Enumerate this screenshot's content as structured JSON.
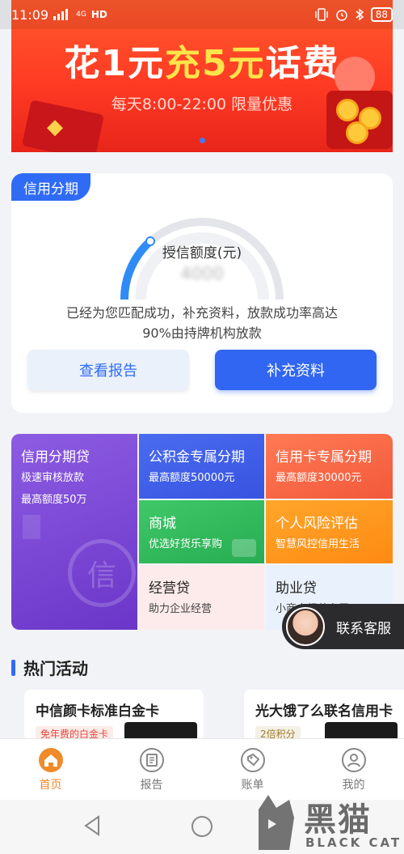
{
  "status_bar": {
    "time": "11:09",
    "network": "4G",
    "hd": "HD",
    "battery": "88"
  },
  "banner": {
    "title_part1": "花1元",
    "title_part2": "充5元",
    "title_part3": "话费",
    "subtitle": "每天8:00-22:00 限量优惠"
  },
  "credit": {
    "tag": "信用分期",
    "gauge_label": "授信额度(元)",
    "gauge_value": "4000",
    "desc_line1": "已经为您匹配成功，补充资料，放款成功率高达",
    "desc_line2": "90%由持牌机构放款",
    "btn_report": "查看报告",
    "btn_supplement": "补充资料"
  },
  "products": {
    "big": {
      "title": "信用分期贷",
      "sub1": "极速审核放款",
      "sub2": "最高额度50万",
      "seal": "信"
    },
    "a": {
      "title": "公积金专属分期",
      "sub": "最高额度50000元"
    },
    "b": {
      "title": "信用卡专属分期",
      "sub": "最高额度30000元"
    },
    "c": {
      "title": "商城",
      "sub": "优选好货乐享购"
    },
    "d": {
      "title": "个人风险评估",
      "sub": "智慧风控信用生活"
    },
    "e": {
      "title": "经营贷",
      "sub": "助力企业经营"
    },
    "f": {
      "title": "助业贷",
      "sub": "小商户经营专属"
    }
  },
  "contact": {
    "label": "联系客服"
  },
  "hot": {
    "title": "热门活动",
    "cards": [
      {
        "title": "中信颜卡标准白金卡",
        "badge": "免年费的白金卡"
      },
      {
        "title": "光大饿了么联名信用卡",
        "badge": "2倍积分"
      }
    ]
  },
  "nav": {
    "items": [
      {
        "label": "首页"
      },
      {
        "label": "报告"
      },
      {
        "label": "账单"
      },
      {
        "label": "我的"
      }
    ]
  },
  "watermark": {
    "cn": "黑猫",
    "en": "BLACK CAT"
  },
  "colors": {
    "accent": "#2f6bf5",
    "nav_active": "#f08a2a",
    "banner_red": "#ff3b24"
  },
  "icons": [
    "signal-icon",
    "vibrate-icon",
    "alarm-icon",
    "bluetooth-icon",
    "battery-icon",
    "home-icon",
    "report-icon",
    "bill-icon",
    "profile-icon",
    "back-icon",
    "home-circle-icon"
  ]
}
